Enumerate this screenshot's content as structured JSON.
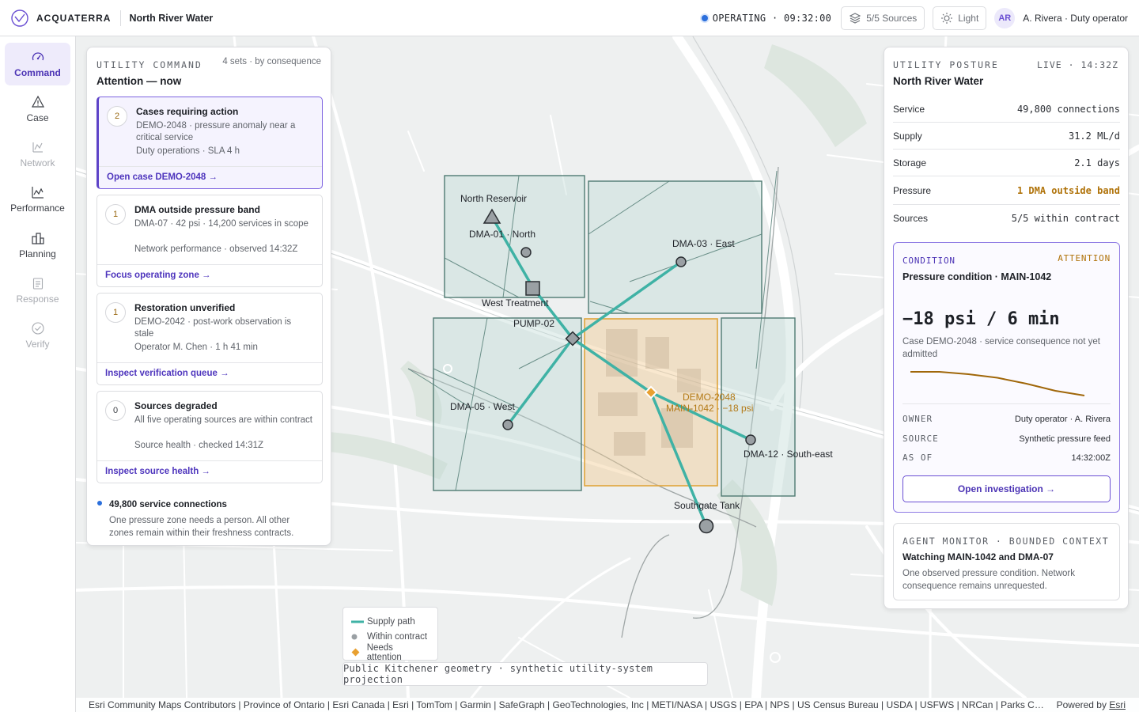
{
  "brand": {
    "name": "ACQUATERRA",
    "utility": "North River Water"
  },
  "topbar": {
    "status": "OPERATING · 09:32:00",
    "sources_button": "5/5 Sources",
    "theme_button": "Light",
    "avatar_initials": "AR",
    "user": "A. Rivera · Duty operator",
    "status_color": "#2b6fdc"
  },
  "nav": [
    {
      "label": "Command",
      "icon": "gauge-icon",
      "state": "active"
    },
    {
      "label": "Case",
      "icon": "warning-triangle-icon",
      "state": "enabled"
    },
    {
      "label": "Network",
      "icon": "network-icon",
      "state": "disabled"
    },
    {
      "label": "Performance",
      "icon": "line-chart-icon",
      "state": "enabled"
    },
    {
      "label": "Planning",
      "icon": "buildings-icon",
      "state": "enabled"
    },
    {
      "label": "Response",
      "icon": "clipboard-icon",
      "state": "disabled"
    },
    {
      "label": "Verify",
      "icon": "check-circle-icon",
      "state": "disabled"
    }
  ],
  "command": {
    "eyebrow": "UTILITY COMMAND",
    "meta": "4 sets · by consequence",
    "title": "Attention — now",
    "cards": [
      {
        "count": "2",
        "title": "Cases requiring action",
        "desc": "DEMO-2048 · pressure anomaly near a critical service",
        "sub": "Duty operations · SLA 4 h",
        "link": "Open case DEMO-2048 →",
        "selected": true
      },
      {
        "count": "1",
        "title": "DMA outside pressure band",
        "desc": "DMA-07 · 42 psi · 14,200 services in scope",
        "sub": "Network performance · observed 14:32Z",
        "link": "Focus operating zone →",
        "selected": false
      },
      {
        "count": "1",
        "title": "Restoration unverified",
        "desc": "DEMO-2042 · post-work observation is stale",
        "sub": "Operator M. Chen · 1 h 41 min",
        "link": "Inspect verification queue →",
        "selected": false
      },
      {
        "count": "0",
        "title": "Sources degraded",
        "desc": "All five operating sources are within contract",
        "sub": "Source health · checked 14:31Z",
        "link": "Inspect source health →",
        "selected": false
      }
    ],
    "service_title": "49,800 service connections",
    "service_desc": "One pressure zone needs a person. All other zones remain within their freshness contracts."
  },
  "posture": {
    "eyebrow": "UTILITY POSTURE",
    "live": "LIVE · 14:32Z",
    "title": "North River Water",
    "metrics": [
      {
        "label": "Service",
        "value": "49,800 connections",
        "warn": false
      },
      {
        "label": "Supply",
        "value": "31.2 ML/d",
        "warn": false
      },
      {
        "label": "Storage",
        "value": "2.1 days",
        "warn": false
      },
      {
        "label": "Pressure",
        "value": "1 DMA outside band",
        "warn": true
      },
      {
        "label": "Sources",
        "value": "5/5 within contract",
        "warn": false
      }
    ],
    "condition": {
      "label": "CONDITION",
      "status": "ATTENTION",
      "title": "Pressure condition · MAIN-1042",
      "value": "−18 psi / 6 min",
      "desc": "Case DEMO-2048 · service consequence not yet admitted",
      "trend": [
        1.0,
        1.0,
        0.9,
        0.75,
        0.5,
        0.2,
        0.0
      ],
      "trend_color": "#a0670a",
      "owner_key": "OWNER",
      "owner": "Duty operator · A. Rivera",
      "source_key": "SOURCE",
      "source": "Synthetic pressure feed",
      "asof_key": "AS OF",
      "asof": "14:32:00Z",
      "action": "Open investigation →"
    },
    "agent": {
      "eyebrow": "AGENT MONITOR · BOUNDED CONTEXT",
      "title": "Watching MAIN-1042 and DMA-07",
      "desc": "One observed pressure condition. Network consequence remains unrequested."
    }
  },
  "map": {
    "zones": [
      {
        "id": "DMA-01",
        "label": "DMA-01 · North",
        "state": "normal"
      },
      {
        "id": "DMA-03",
        "label": "DMA-03 · East",
        "state": "normal"
      },
      {
        "id": "DMA-05",
        "label": "DMA-05 · West",
        "state": "normal"
      },
      {
        "id": "DMA-07",
        "label": "DEMO-2048",
        "state": "attention"
      },
      {
        "id": "DMA-12",
        "label": "DMA-12 · South-east",
        "state": "normal"
      }
    ],
    "assets": {
      "reservoir": "North Reservoir",
      "treatment": "West Treatment",
      "pump": "PUMP-02",
      "tank": "Southgate Tank",
      "case_label": "DEMO-2048",
      "case_sub": "MAIN-1042 · −18 psi"
    },
    "colors": {
      "supply": "#3fb2a5",
      "zone": "#4f7a72",
      "attention": "#e0a43a",
      "attention_text": "#b37a17"
    }
  },
  "legend": {
    "supply": "Supply path",
    "within": "Within contract",
    "attention": "Needs attention"
  },
  "projection_note": "Public Kitchener geometry · synthetic utility-system projection",
  "attribution": {
    "text": "Esri Community Maps Contributors | Province of Ontario | Esri Canada | Esri | TomTom | Garmin | SafeGraph | GeoTechnologies, Inc | METI/NASA | USGS | EPA | NPS | US Census Bureau | USDA | USFWS | NRCan | Parks Canada",
    "powered": "Powered by",
    "powered_link": "Esri"
  }
}
